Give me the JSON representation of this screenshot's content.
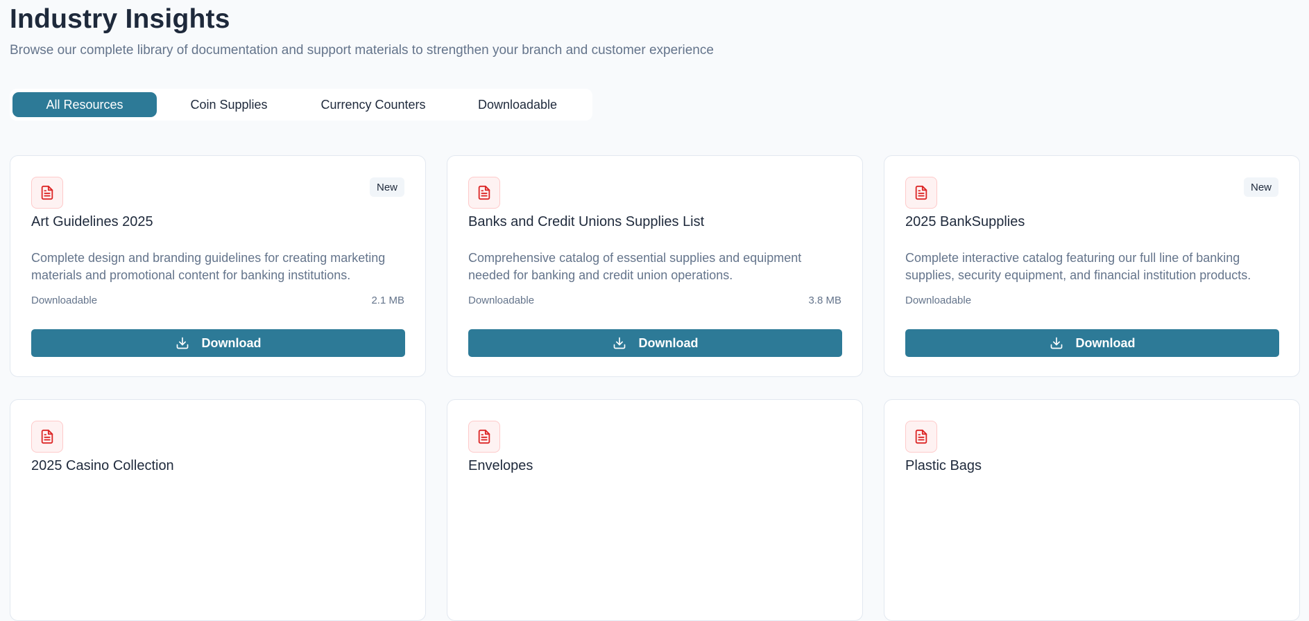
{
  "header": {
    "title": "Industry Insights",
    "subtitle": "Browse our complete library of documentation and support materials to strengthen your branch and customer experience"
  },
  "tabs": [
    {
      "label": "All Resources",
      "active": true
    },
    {
      "label": "Coin Supplies",
      "active": false
    },
    {
      "label": "Currency Counters",
      "active": false
    },
    {
      "label": "Downloadable",
      "active": false
    }
  ],
  "icons": {
    "file": "file-text-icon",
    "download": "download-icon"
  },
  "colors": {
    "accent": "#2d7a97",
    "icon_red": "#dc2626",
    "icon_bg": "#fef2f2"
  },
  "cards": [
    {
      "title": "Art Guidelines 2025",
      "badge": "New",
      "description": "Complete design and branding guidelines for creating marketing materials and promotional content for banking institutions.",
      "type": "Downloadable",
      "size": "2.1 MB",
      "button": "Download"
    },
    {
      "title": "Banks and Credit Unions Supplies List",
      "badge": "",
      "description": "Comprehensive catalog of essential supplies and equipment needed for banking and credit union operations.",
      "type": "Downloadable",
      "size": "3.8 MB",
      "button": "Download"
    },
    {
      "title": "2025 BankSupplies",
      "badge": "New",
      "description": "Complete interactive catalog featuring our full line of banking supplies, security equipment, and financial institution products.",
      "type": "Downloadable",
      "size": "",
      "button": "Download"
    },
    {
      "title": "2025 Casino Collection"
    },
    {
      "title": "Envelopes"
    },
    {
      "title": "Plastic Bags"
    }
  ]
}
